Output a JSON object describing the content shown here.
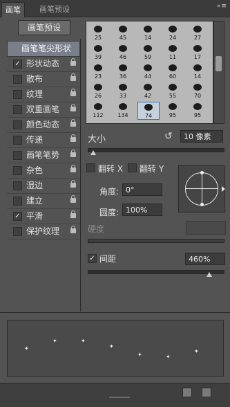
{
  "tabs": {
    "active": "画笔",
    "inactive": "画笔预设"
  },
  "menu_icon": "»≡",
  "preset_button": "画笔预设",
  "brush_tip_shape": "画笔笔尖形状",
  "options": [
    {
      "label": "形状动态",
      "checked": true
    },
    {
      "label": "散布",
      "checked": false
    },
    {
      "label": "纹理",
      "checked": false
    },
    {
      "label": "双重画笔",
      "checked": false
    },
    {
      "label": "颜色动态",
      "checked": false
    },
    {
      "label": "传递",
      "checked": false
    },
    {
      "label": "画笔笔势",
      "checked": false
    },
    {
      "label": "杂色",
      "checked": false
    },
    {
      "label": "湿边",
      "checked": false
    },
    {
      "label": "建立",
      "checked": false
    },
    {
      "label": "平滑",
      "checked": true
    },
    {
      "label": "保护纹理",
      "checked": false
    }
  ],
  "brush_grid": [
    [
      "25",
      "45",
      "14",
      "24",
      "27"
    ],
    [
      "39",
      "46",
      "59",
      "11",
      "17"
    ],
    [
      "23",
      "36",
      "44",
      "60",
      "14"
    ],
    [
      "26",
      "33",
      "42",
      "55",
      "70"
    ],
    [
      "112",
      "134",
      "74",
      "95",
      "95"
    ]
  ],
  "selected_brush": "74",
  "size": {
    "label": "大小",
    "value": "10 像素",
    "slider_pct": 0.04
  },
  "flip_x": {
    "label": "翻转 X"
  },
  "flip_y": {
    "label": "翻转 Y"
  },
  "angle": {
    "label": "角度:",
    "value": "0°"
  },
  "roundness": {
    "label": "圆度:",
    "value": "100%"
  },
  "hardness": {
    "label": "硬度"
  },
  "spacing": {
    "label": "间距",
    "value": "460%",
    "slider_pct": 0.9
  },
  "icons": {
    "lock": "lock-icon",
    "reset": "reset-size-icon",
    "new_brush": "new-brush-icon",
    "toggle": "toggle-brush-icon"
  }
}
